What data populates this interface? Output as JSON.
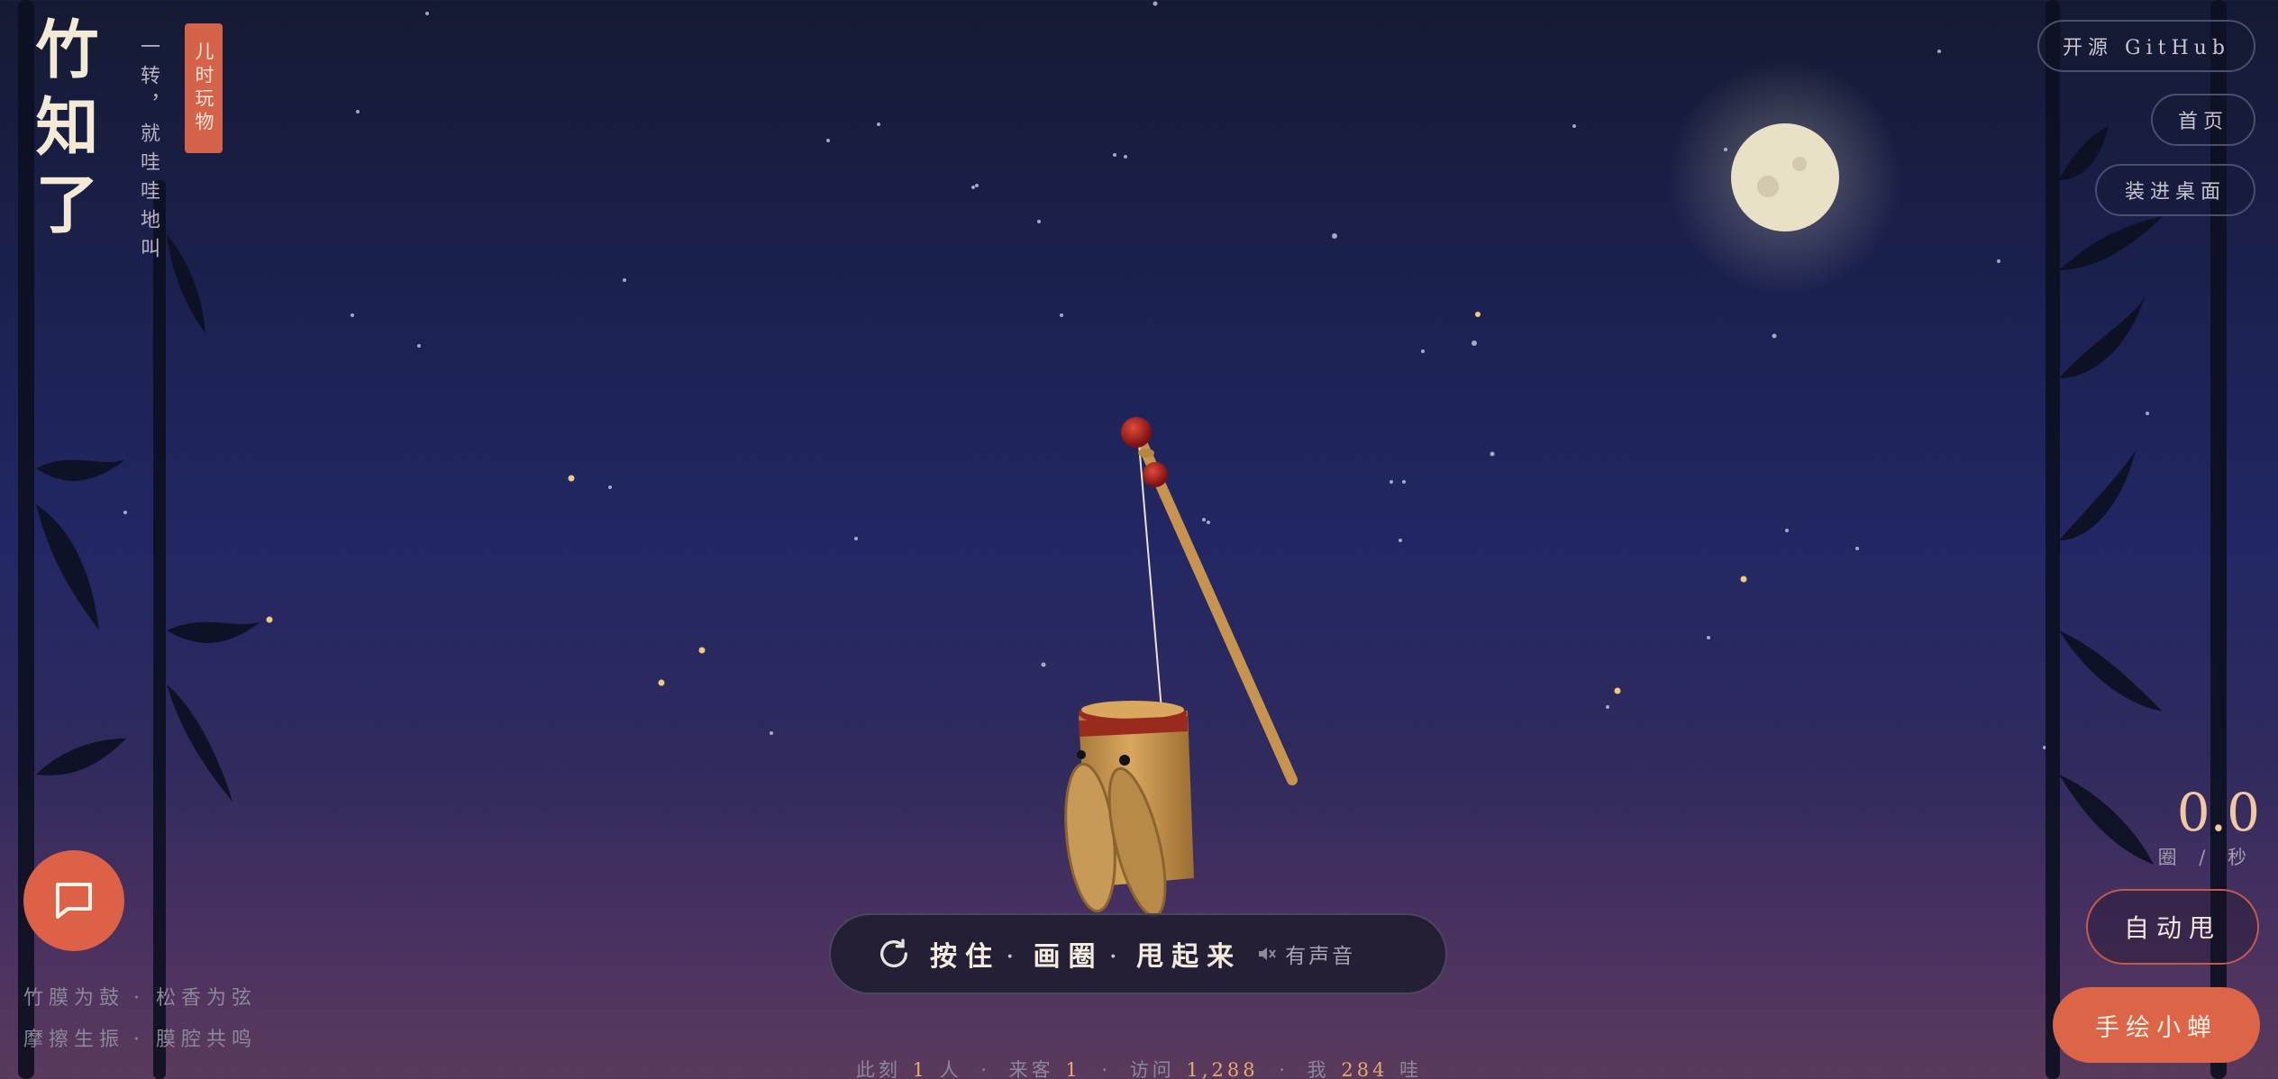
{
  "brand": {
    "title": "竹知了",
    "slogan": "一转，就哇哇地叫",
    "seal": "儿时玩物"
  },
  "nav": {
    "github": "开源 GitHub",
    "home": "首页",
    "desktop": "装进桌面"
  },
  "speed": {
    "value": "0.0",
    "unit": "圈 / 秒"
  },
  "actions": {
    "auto_label": "自动甩",
    "draw_label": "手绘小蝉"
  },
  "instructions": {
    "step1": "按住",
    "step2": "画圈",
    "step3": "甩起来",
    "sep": "·",
    "sound": "有声音"
  },
  "captions": {
    "line1_a": "竹膜为鼓",
    "line1_b": "松香为弦",
    "line2_a": "摩擦生振",
    "line2_b": "膜腔共鸣",
    "sep": "·"
  },
  "stats": {
    "now_label": "此刻",
    "now_value": "1",
    "now_unit": "人",
    "guest_label": "来客",
    "guest_value": "1",
    "visit_label": "访问",
    "visit_value": "1,288",
    "me_label": "我",
    "me_value": "284",
    "me_unit": "哇",
    "sep": "·"
  },
  "icons": {
    "chat": "chat-bubble-icon",
    "rotate": "rotate-icon",
    "sound": "speaker-icon"
  },
  "colors": {
    "accent": "#dc6447",
    "moon": "#e9e1c6",
    "highlight": "#e6a96f"
  }
}
